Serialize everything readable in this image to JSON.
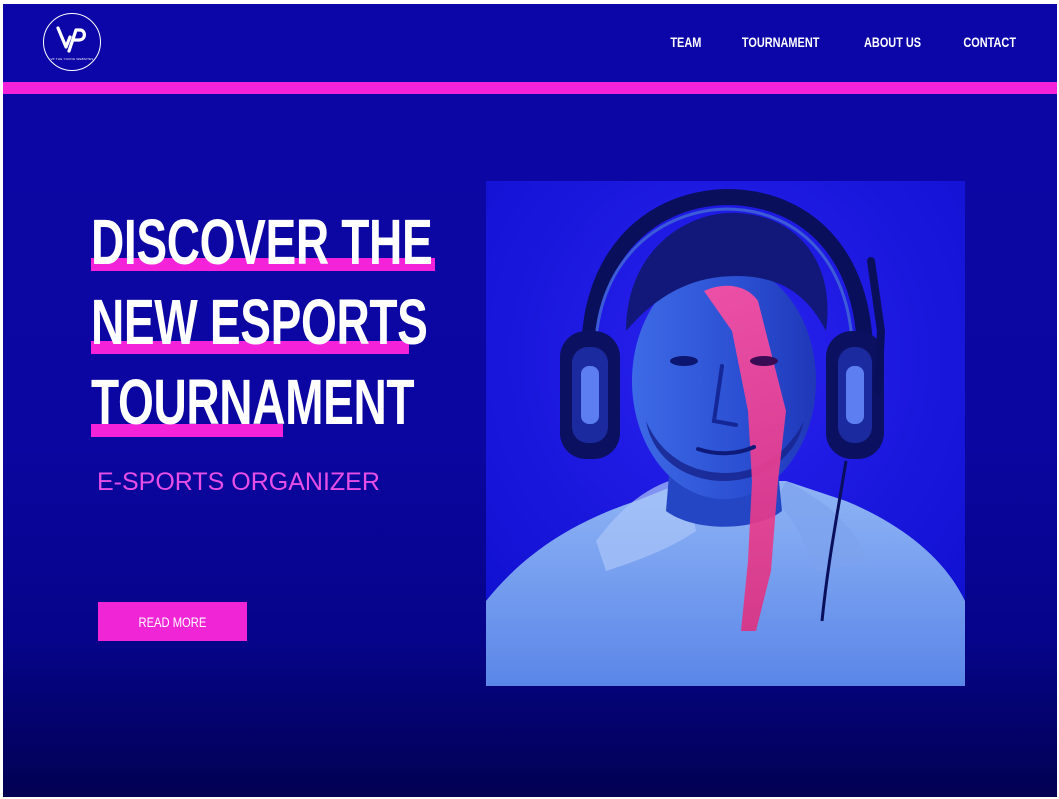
{
  "header": {
    "logo": {
      "icon": "vp-monogram-logo",
      "caption": "VP THE YOUNG WEBSITES"
    },
    "nav": [
      {
        "label": "TEAM"
      },
      {
        "label": "TOURNAMENT"
      },
      {
        "label": "ABOUT US"
      },
      {
        "label": "CONTACT"
      }
    ]
  },
  "hero": {
    "headline_lines": [
      "DISCOVER THE",
      "NEW ESPORTS",
      "TOURNAMENT"
    ],
    "subtitle": "E-SPORTS ORGANIZER",
    "cta_label": "READ MORE",
    "image": "gamer-with-headphones-photo"
  },
  "colors": {
    "background": "#0c06a8",
    "accent_pink": "#f422d8",
    "subtitle_pink": "#e64ee6",
    "text": "#ffffff"
  }
}
